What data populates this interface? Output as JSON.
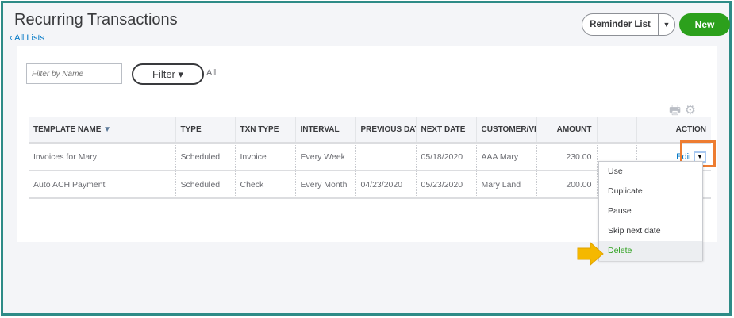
{
  "page": {
    "title": "Recurring Transactions",
    "back_link": "All Lists"
  },
  "header": {
    "reminder_list": "Reminder List",
    "new": "New"
  },
  "toolbar": {
    "filter_placeholder": "Filter by Name",
    "filter_label": "Filter",
    "filter_value": "All"
  },
  "table": {
    "columns": [
      "TEMPLATE NAME",
      "TYPE",
      "TXN TYPE",
      "INTERVAL",
      "PREVIOUS DAT",
      "NEXT DATE",
      "CUSTOMER/VE",
      "AMOUNT",
      "",
      "ACTION"
    ],
    "rows": [
      {
        "name": "Invoices for Mary",
        "type": "Scheduled",
        "txn_type": "Invoice",
        "interval": "Every Week",
        "previous": "",
        "next": "05/18/2020",
        "customer": "AAA Mary",
        "amount": "230.00",
        "action": "Edit"
      },
      {
        "name": "Auto ACH Payment",
        "type": "Scheduled",
        "txn_type": "Check",
        "interval": "Every Month",
        "previous": "04/23/2020",
        "next": "05/23/2020",
        "customer": "Mary Land",
        "amount": "200.00",
        "action": ""
      }
    ]
  },
  "menu": {
    "items": [
      "Use",
      "Duplicate",
      "Pause",
      "Skip next date",
      "Delete"
    ]
  },
  "colors": {
    "accent": "#2ca01c",
    "link": "#0077c5",
    "frame": "#2e8b87",
    "highlight": "#ed7c31",
    "arrow": "#f5b800"
  }
}
